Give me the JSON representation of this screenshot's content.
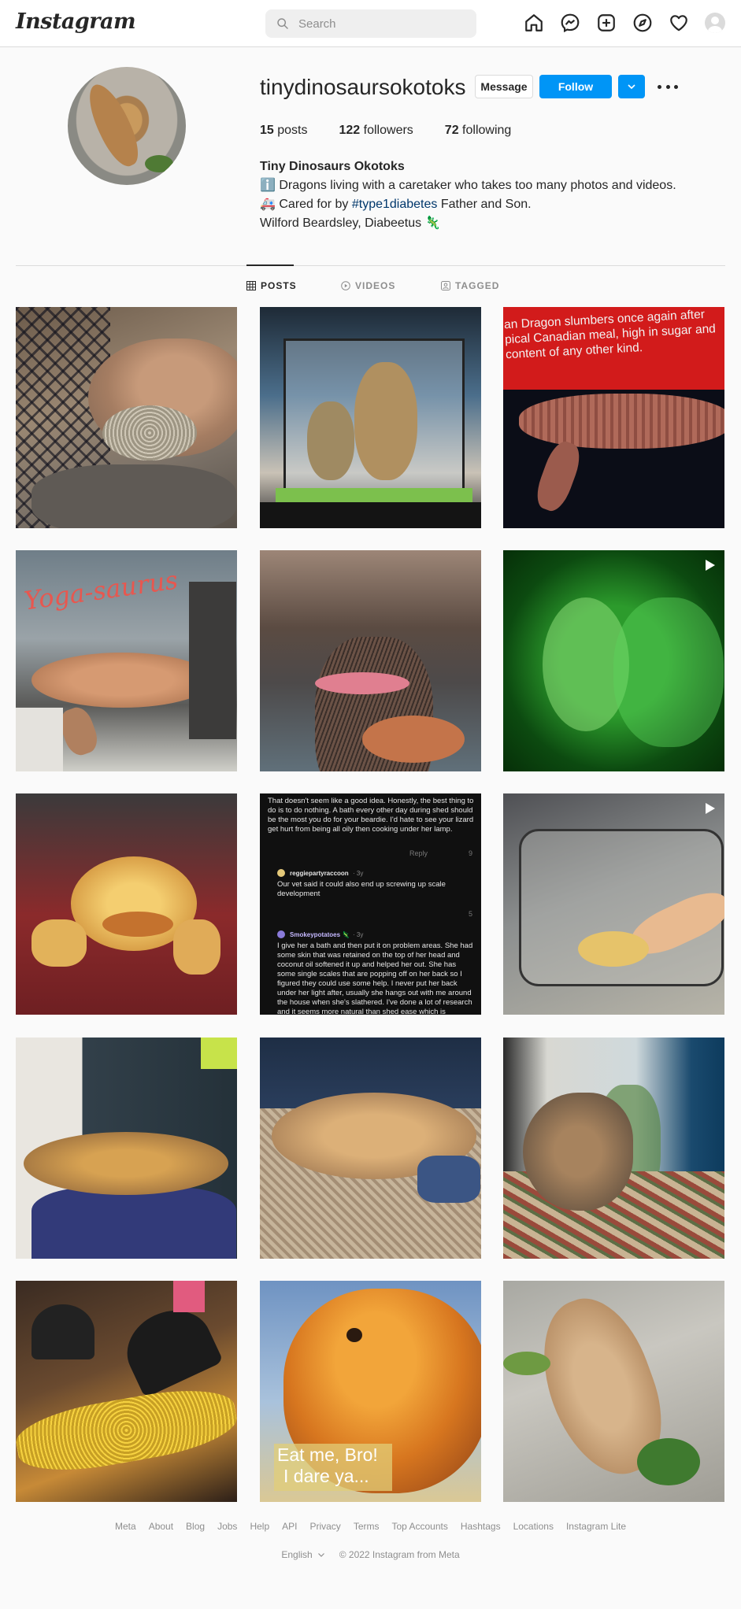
{
  "nav": {
    "logo": "Instagram",
    "search_placeholder": "Search",
    "icons": [
      "home-icon",
      "messenger-icon",
      "new-post-icon",
      "explore-icon",
      "activity-heart-icon",
      "profile-avatar"
    ]
  },
  "profile": {
    "username": "tinydinosaursokotoks",
    "buttons": {
      "message": "Message",
      "follow": "Follow"
    },
    "stats": {
      "posts_count": "15",
      "posts_label": "posts",
      "followers_count": "122",
      "followers_label": "followers",
      "following_count": "72",
      "following_label": "following"
    },
    "bio": {
      "full_name": "Tiny Dinosaurs Okotoks",
      "line1": "ℹ️ Dragons living with a caretaker who takes too many photos and videos.",
      "line2_prefix": "🚑 Cared for by ",
      "line2_hashtag": "#type1diabetes",
      "line2_suffix": " Father and Son.",
      "line3": "Wilford Beardsley, Diabeetus 🦎"
    }
  },
  "tabs": [
    {
      "label": "POSTS",
      "icon": "grid-icon",
      "active": true
    },
    {
      "label": "VIDEOS",
      "icon": "play-circle-icon",
      "active": false
    },
    {
      "label": "TAGGED",
      "icon": "tagged-icon",
      "active": false
    }
  ],
  "posts": {
    "post3_caption": "an Dragon slumbers once again after pical Canadian meal, high in sugar and content of any other kind.",
    "post4_caption": "Yoga-saurus",
    "post8_comments": {
      "c1": "That doesn't seem like a good idea.  Honestly, the best thing to do is to do nothing.  A bath every other day during shed should be the most you do for your beardie.  I'd hate to see your lizard get hurt from being all oily then cooking under her lamp.",
      "reply_label": "Reply",
      "c1_votes": "9",
      "u2": "reggiepartyraccoon",
      "u2_age": "· 3y",
      "c2": "Our vet said it could also end up screwing up scale development",
      "c2_votes": "5",
      "u3": "Smokeypotatoes 🦎",
      "u3_age": "· 3y",
      "c3": "I give her a bath and then put it on problem areas. She had some skin that was retained on the top of her head and coconut oil softened it up and helped her out. She has some single scales that are popping off on her back so I figured they could use some help. I never put her back under her light after, usually she hangs out with me around the house when she's slathered. I've done a lot of research and it seems more natural than shed ease which is basically just glycerin."
    },
    "post14_caption_line1": "Eat me, Bro!",
    "post14_caption_line2": "I dare ya..."
  },
  "footer": {
    "links": [
      "Meta",
      "About",
      "Blog",
      "Jobs",
      "Help",
      "API",
      "Privacy",
      "Terms",
      "Top Accounts",
      "Hashtags",
      "Locations",
      "Instagram Lite"
    ],
    "language": "English",
    "copyright": "© 2022 Instagram from Meta"
  },
  "colors": {
    "accent": "#0095f6",
    "hashtag": "#00376b",
    "border": "#dbdbdb",
    "muted": "#8e8e8e",
    "background": "#fafafa"
  }
}
